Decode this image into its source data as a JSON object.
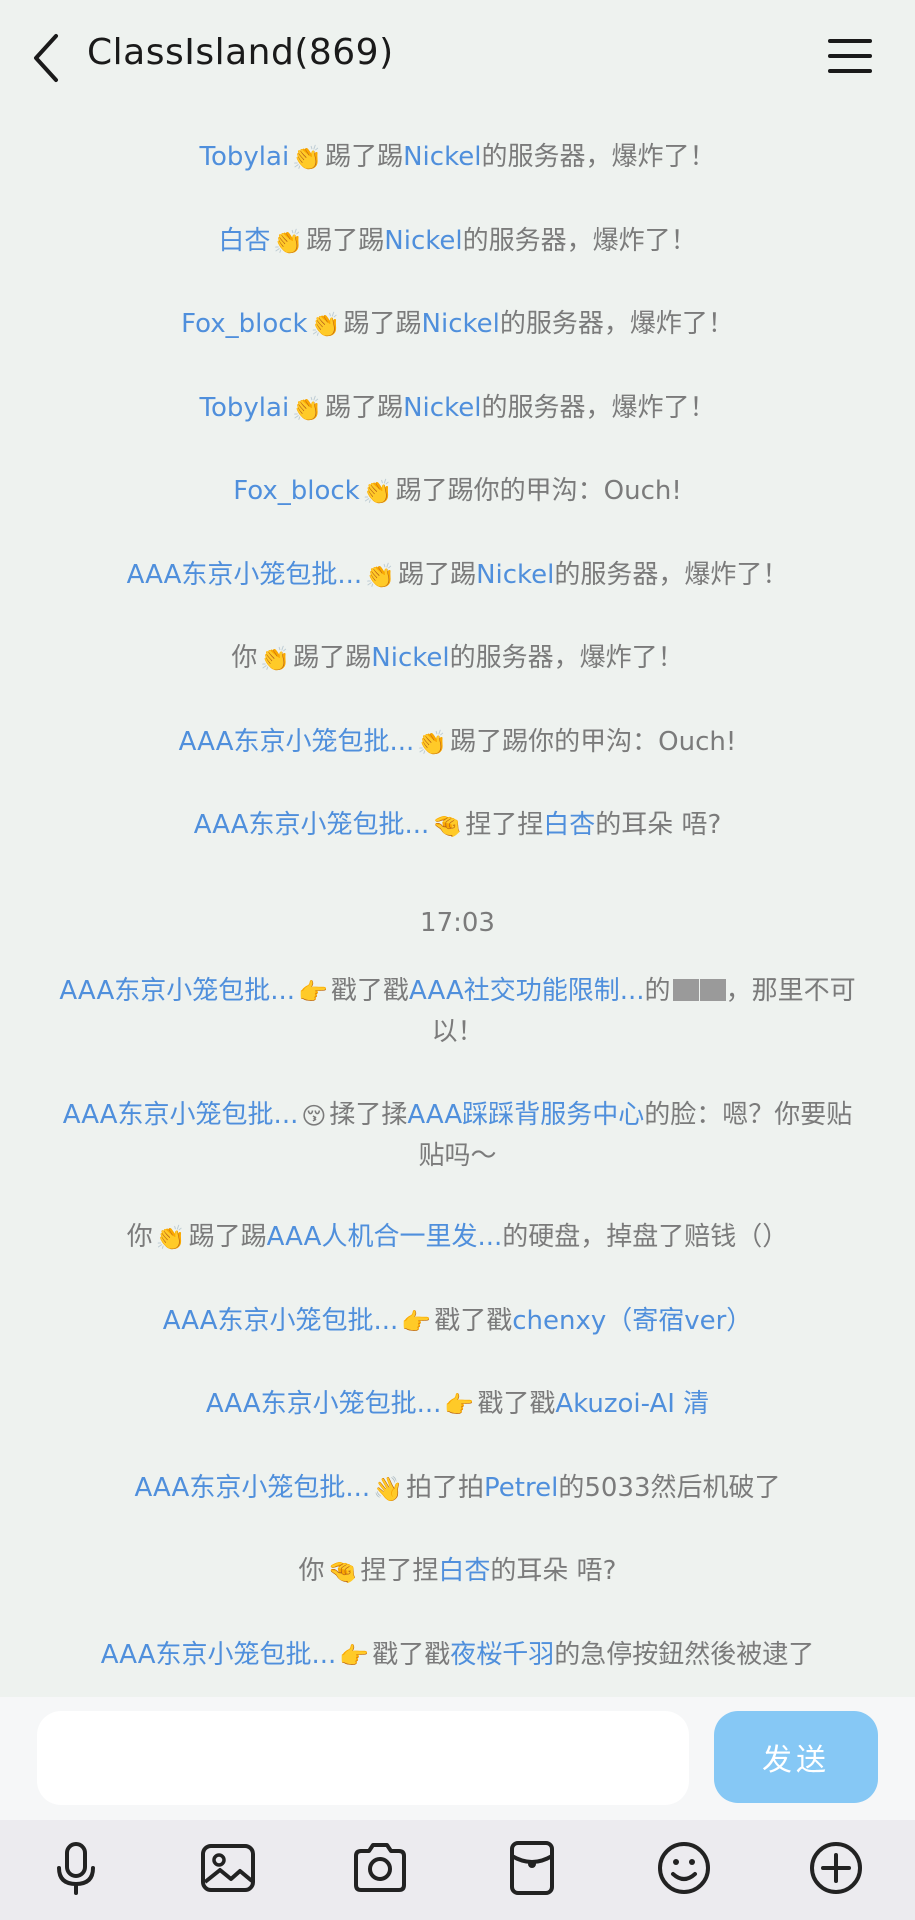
{
  "header": {
    "title": "ClassIsland(869)"
  },
  "messages": [
    {
      "parts": [
        {
          "k": "n",
          "t": "Tobylai"
        },
        {
          "k": "e",
          "t": "👏"
        },
        {
          "k": "t",
          "t": "踢了踢"
        },
        {
          "k": "n",
          "t": "Nickel"
        },
        {
          "k": "t",
          "t": "的服务器，爆炸了！"
        }
      ]
    },
    {
      "parts": [
        {
          "k": "n",
          "t": "白杏"
        },
        {
          "k": "e",
          "t": "👏"
        },
        {
          "k": "t",
          "t": "踢了踢"
        },
        {
          "k": "n",
          "t": "Nickel"
        },
        {
          "k": "t",
          "t": "的服务器，爆炸了！"
        }
      ]
    },
    {
      "parts": [
        {
          "k": "n",
          "t": "Fox_block"
        },
        {
          "k": "e",
          "t": "👏"
        },
        {
          "k": "t",
          "t": "踢了踢"
        },
        {
          "k": "n",
          "t": "Nickel"
        },
        {
          "k": "t",
          "t": "的服务器，爆炸了！"
        }
      ]
    },
    {
      "parts": [
        {
          "k": "n",
          "t": "Tobylai"
        },
        {
          "k": "e",
          "t": "👏"
        },
        {
          "k": "t",
          "t": "踢了踢"
        },
        {
          "k": "n",
          "t": "Nickel"
        },
        {
          "k": "t",
          "t": "的服务器，爆炸了！"
        }
      ]
    },
    {
      "parts": [
        {
          "k": "n",
          "t": "Fox_block"
        },
        {
          "k": "e",
          "t": "👏"
        },
        {
          "k": "t",
          "t": "踢了踢你的甲沟：Ouch!"
        }
      ]
    },
    {
      "parts": [
        {
          "k": "n",
          "t": "AAA东京小笼包批..."
        },
        {
          "k": "e",
          "t": "👏"
        },
        {
          "k": "t",
          "t": "踢了踢"
        },
        {
          "k": "n",
          "t": "Nickel"
        },
        {
          "k": "t",
          "t": "的服务器，爆炸了！"
        }
      ]
    },
    {
      "parts": [
        {
          "k": "t",
          "t": "你"
        },
        {
          "k": "e",
          "t": "👏"
        },
        {
          "k": "t",
          "t": "踢了踢"
        },
        {
          "k": "n",
          "t": "Nickel"
        },
        {
          "k": "t",
          "t": "的服务器，爆炸了！"
        }
      ]
    },
    {
      "parts": [
        {
          "k": "n",
          "t": "AAA东京小笼包批..."
        },
        {
          "k": "e",
          "t": "👏"
        },
        {
          "k": "t",
          "t": "踢了踢你的甲沟：Ouch!"
        }
      ]
    },
    {
      "parts": [
        {
          "k": "n",
          "t": "AAA东京小笼包批..."
        },
        {
          "k": "e",
          "t": "🤏"
        },
        {
          "k": "t",
          "t": "捏了捏"
        },
        {
          "k": "n",
          "t": "白杏"
        },
        {
          "k": "t",
          "t": "的耳朵 唔?"
        }
      ]
    },
    {
      "parts": [
        {
          "k": "n",
          "t": "AAA东京小笼包批..."
        },
        {
          "k": "e",
          "t": "👉"
        },
        {
          "k": "t",
          "t": "戳了戳"
        },
        {
          "k": "n",
          "t": "AAA社交功能限制..."
        },
        {
          "k": "t",
          "t": "的"
        },
        {
          "k": "b",
          "t": "██"
        },
        {
          "k": "t",
          "t": "，那里不可以！"
        }
      ]
    },
    {
      "parts": [
        {
          "k": "n",
          "t": "AAA东京小笼包批..."
        },
        {
          "k": "e",
          "t": "😚"
        },
        {
          "k": "t",
          "t": "揉了揉"
        },
        {
          "k": "n",
          "t": "AAA踩踩背服务中心"
        },
        {
          "k": "t",
          "t": "的脸：嗯？你要贴贴吗～"
        }
      ]
    },
    {
      "parts": [
        {
          "k": "t",
          "t": "你"
        },
        {
          "k": "e",
          "t": "👏"
        },
        {
          "k": "t",
          "t": "踢了踢"
        },
        {
          "k": "n",
          "t": "AAA人机合一里发..."
        },
        {
          "k": "t",
          "t": "的硬盘，掉盘了赔钱（）"
        }
      ]
    },
    {
      "parts": [
        {
          "k": "n",
          "t": "AAA东京小笼包批..."
        },
        {
          "k": "e",
          "t": "👉"
        },
        {
          "k": "t",
          "t": "戳了戳"
        },
        {
          "k": "n",
          "t": "chenxy（寄宿ver）"
        }
      ]
    },
    {
      "parts": [
        {
          "k": "n",
          "t": "AAA东京小笼包批..."
        },
        {
          "k": "e",
          "t": "👉"
        },
        {
          "k": "t",
          "t": "戳了戳"
        },
        {
          "k": "n",
          "t": "Akuzoi-AI 清"
        }
      ]
    },
    {
      "parts": [
        {
          "k": "n",
          "t": "AAA东京小笼包批..."
        },
        {
          "k": "e",
          "t": "👋"
        },
        {
          "k": "t",
          "t": "拍了拍"
        },
        {
          "k": "n",
          "t": "Petrel"
        },
        {
          "k": "t",
          "t": "的5033然后机破了"
        }
      ]
    },
    {
      "parts": [
        {
          "k": "t",
          "t": "你"
        },
        {
          "k": "e",
          "t": "🤏"
        },
        {
          "k": "t",
          "t": "捏了捏"
        },
        {
          "k": "n",
          "t": "白杏"
        },
        {
          "k": "t",
          "t": "的耳朵 唔?"
        }
      ]
    },
    {
      "parts": [
        {
          "k": "n",
          "t": "AAA东京小笼包批..."
        },
        {
          "k": "e",
          "t": "👉"
        },
        {
          "k": "t",
          "t": "戳了戳"
        },
        {
          "k": "n",
          "t": "夜桜千羽"
        },
        {
          "k": "t",
          "t": "的急停按鈕然後被逮了"
        }
      ]
    }
  ],
  "timestamp": "17:03",
  "composer": {
    "placeholder": "",
    "send_label": "发送"
  },
  "toolbar": {
    "icons": [
      "microphone-icon",
      "image-icon",
      "camera-icon",
      "red-packet-icon",
      "emoji-icon",
      "plus-icon"
    ]
  },
  "colors": {
    "name": "#4f8fdc",
    "text": "#7b7b7b",
    "send": "#86c8f5",
    "background": "#eef2ef"
  }
}
